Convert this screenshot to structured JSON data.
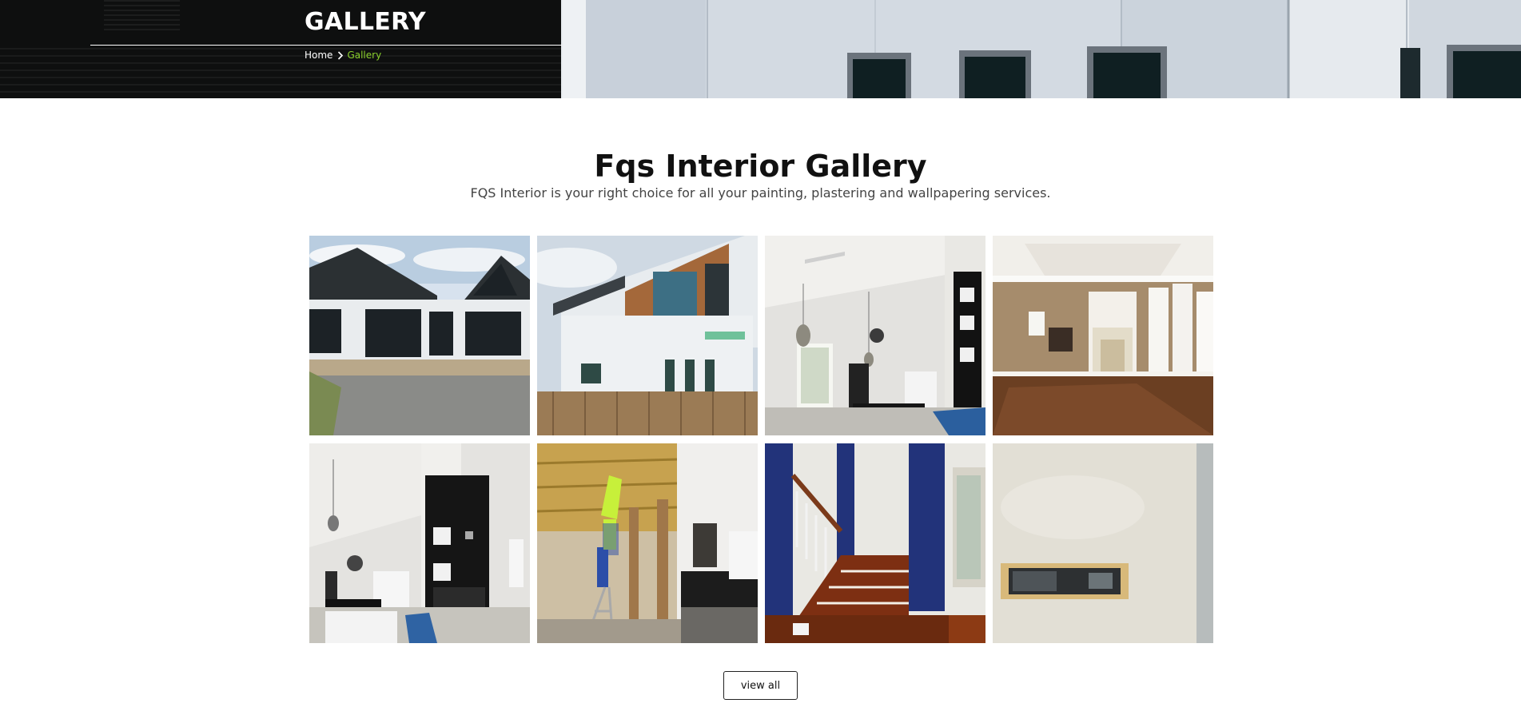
{
  "hero": {
    "title": "GALLERY",
    "breadcrumb": {
      "home": "Home",
      "current": "Gallery"
    },
    "accent_color": "#8ad02c"
  },
  "gallery": {
    "title": "Fqs Interior Gallery",
    "subtitle": "FQS Interior is your right choice for all your painting, plastering and wallpapering services.",
    "images": [
      {
        "subject": "house exterior with black roof and sliding doors"
      },
      {
        "subject": "two storey house with timber cladding"
      },
      {
        "subject": "kitchen with pendant lights and ceiling fan"
      },
      {
        "subject": "empty living room with fireplace"
      },
      {
        "subject": "kitchen with black cabinetry"
      },
      {
        "subject": "worker on ladder installing ceiling insulation"
      },
      {
        "subject": "staircase with blue wall"
      },
      {
        "subject": "plastered wall with small window"
      }
    ]
  },
  "actions": {
    "view_all_label": "view all"
  },
  "icons": {
    "breadcrumb_separator": "chevron-right-icon"
  }
}
